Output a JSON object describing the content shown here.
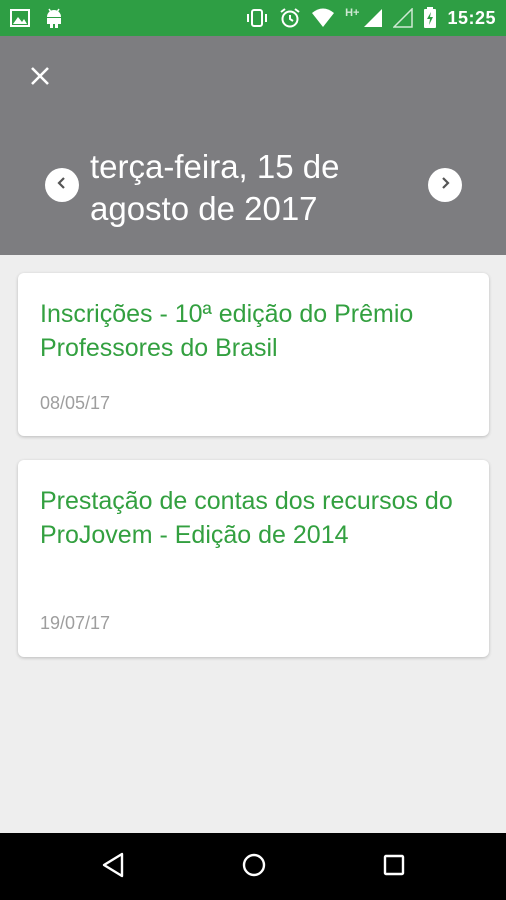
{
  "status_bar": {
    "time": "15:25",
    "network_label": "H+",
    "icons_left": [
      "image-icon",
      "android-icon"
    ],
    "icons_right": [
      "vibrate-icon",
      "alarm-icon",
      "wifi-icon",
      "signal-icon",
      "signal-empty-icon",
      "battery-charging-icon"
    ]
  },
  "header": {
    "date_title": "terça-feira, 15 de agosto de 2017",
    "close_icon": "close-icon",
    "prev_icon": "chevron-left-icon",
    "next_icon": "chevron-right-icon"
  },
  "events": [
    {
      "title": "Inscrições - 10ª edição do Prêmio Professores do Brasil",
      "date": "08/05/17"
    },
    {
      "title": "Prestação de contas dos recursos do ProJovem - Edição de 2014",
      "date": "19/07/17"
    }
  ],
  "nav_bar": {
    "icons": [
      "back-icon",
      "home-icon",
      "recents-icon"
    ]
  },
  "colors": {
    "status_bar": "#2e9e44",
    "header": "#7d7d80",
    "accent_text": "#33a040",
    "date_text": "#9e9e9e",
    "background": "#eeeeee"
  }
}
